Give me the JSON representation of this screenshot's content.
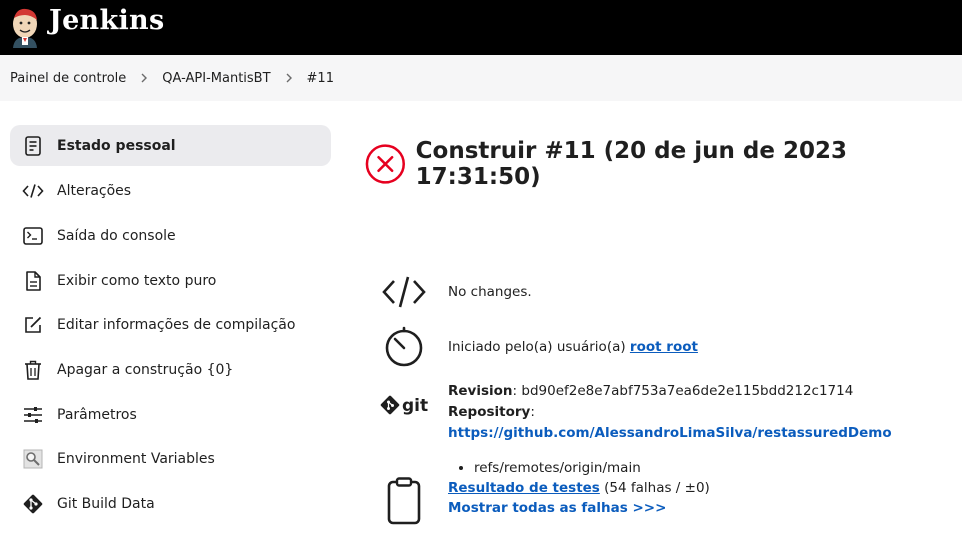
{
  "header": {
    "brand": "Jenkins"
  },
  "breadcrumb": {
    "items": [
      {
        "label": "Painel de controle"
      },
      {
        "label": "QA-API-MantisBT"
      },
      {
        "label": "#11"
      }
    ]
  },
  "sidebar": {
    "items": [
      {
        "label": "Estado pessoal",
        "icon": "document-icon"
      },
      {
        "label": "Alterações",
        "icon": "code-icon"
      },
      {
        "label": "Saída do console",
        "icon": "terminal-icon"
      },
      {
        "label": "Exibir como texto puro",
        "icon": "file-icon"
      },
      {
        "label": "Editar informações de compilação",
        "icon": "edit-icon"
      },
      {
        "label": "Apagar a construção {0}",
        "icon": "trash-icon"
      },
      {
        "label": "Parâmetros",
        "icon": "sliders-icon"
      },
      {
        "label": "Environment Variables",
        "icon": "magnifier-icon"
      },
      {
        "label": "Git Build Data",
        "icon": "git-icon"
      }
    ]
  },
  "main": {
    "title": "Construir #11 (20 de jun de 2023 17:31:50)",
    "status_color": "#e6001f",
    "changes": {
      "text": "No changes."
    },
    "started": {
      "prefix": "Iniciado pelo(a) usuário(a) ",
      "user": "root root"
    },
    "git": {
      "revision_label": "Revision",
      "revision_value": ": bd90ef2e8e7abf753a7ea6de2e115bdd212c1714",
      "repository_label": "Repository",
      "repository_sep": ": ",
      "repository_url": "https://github.com/AlessandroLimaSilva/restassuredDemo",
      "branch": "refs/remotes/origin/main"
    },
    "tests": {
      "link": "Resultado de testes",
      "summary": " (54 falhas / ±0)",
      "show_all": "Mostrar todas as falhas >>>"
    }
  }
}
